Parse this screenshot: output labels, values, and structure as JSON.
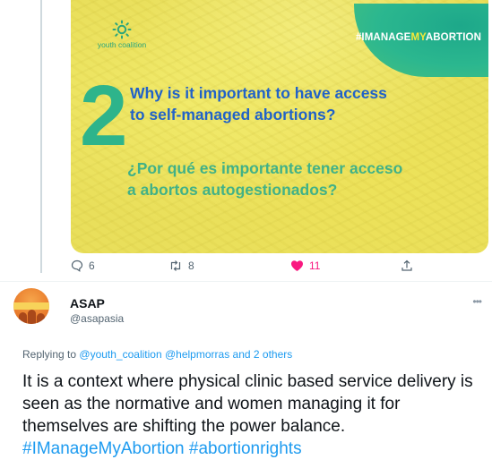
{
  "media": {
    "logo_text": "youth coalition",
    "hashtag_banner": {
      "part1": "#IMANAGE",
      "part2": "MY",
      "part3": "ABORTION"
    },
    "number": "2",
    "question_en_line1": "Why is it important to have access",
    "question_en_line2": "to self-managed abortions?",
    "question_es_line1": "¿Por qué es importante tener acceso",
    "question_es_line2": "a abortos autogestionados?",
    "colors": {
      "background": "#e9df5b",
      "english_text": "#2162c8",
      "spanish_text": "#41b187",
      "number": "#2eb48b",
      "banner": "#2bb78f"
    }
  },
  "actions": {
    "reply_count": "6",
    "retweet_count": "8",
    "like_count": "11",
    "like_color": "#f91880",
    "icons": [
      "reply-icon",
      "retweet-icon",
      "heart-icon",
      "share-icon"
    ]
  },
  "reply": {
    "name": "ASAP",
    "handle": "@asapasia",
    "more": "•••",
    "replying_prefix": "Replying to",
    "replying_links": [
      "@youth_coalition",
      "@helpmorras",
      "and 2 others"
    ],
    "text": "It is a context where physical clinic based service delivery is seen as the normative and women managing it for themselves are shifting the power balance.",
    "hashtags": [
      "#IManageMyAbortion",
      "#abortionrights"
    ],
    "accent_color": "#1d9bf0"
  }
}
